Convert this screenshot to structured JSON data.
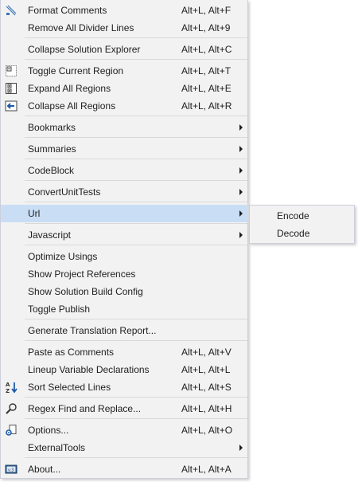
{
  "menu": {
    "format_comments": {
      "label": "Format Comments",
      "shortcut": "Alt+L, Alt+F",
      "icon": "comment-format-icon"
    },
    "remove_divider_lines": {
      "label": "Remove All Divider Lines",
      "shortcut": "Alt+L, Alt+9"
    },
    "collapse_solution_explorer": {
      "label": "Collapse Solution Explorer",
      "shortcut": "Alt+L, Alt+C"
    },
    "toggle_current_region": {
      "label": "Toggle Current Region",
      "shortcut": "Alt+L, Alt+T",
      "icon": "toggle-region-icon"
    },
    "expand_all_regions": {
      "label": "Expand All Regions",
      "shortcut": "Alt+L, Alt+E",
      "icon": "expand-regions-icon"
    },
    "collapse_all_regions": {
      "label": "Collapse All Regions",
      "shortcut": "Alt+L, Alt+R",
      "icon": "collapse-regions-icon"
    },
    "bookmarks": {
      "label": "Bookmarks"
    },
    "summaries": {
      "label": "Summaries"
    },
    "codeblock": {
      "label": "CodeBlock"
    },
    "convert_unit_tests": {
      "label": "ConvertUnitTests"
    },
    "url": {
      "label": "Url"
    },
    "javascript": {
      "label": "Javascript"
    },
    "optimize_usings": {
      "label": "Optimize Usings"
    },
    "show_project_references": {
      "label": "Show Project References"
    },
    "show_solution_build_config": {
      "label": "Show Solution Build Config"
    },
    "toggle_publish": {
      "label": "Toggle Publish"
    },
    "generate_translation_report": {
      "label": "Generate Translation Report..."
    },
    "paste_as_comments": {
      "label": "Paste as Comments",
      "shortcut": "Alt+L, Alt+V"
    },
    "lineup_variable_declarations": {
      "label": "Lineup Variable Declarations",
      "shortcut": "Alt+L, Alt+L"
    },
    "sort_selected_lines": {
      "label": "Sort Selected Lines",
      "shortcut": "Alt+L, Alt+S",
      "icon": "sort-az-icon"
    },
    "regex_find_replace": {
      "label": "Regex Find and Replace...",
      "shortcut": "Alt+L, Alt+H",
      "icon": "search-icon"
    },
    "options": {
      "label": "Options...",
      "shortcut": "Alt+L, Alt+O",
      "icon": "options-gear-icon"
    },
    "external_tools": {
      "label": "ExternalTools"
    },
    "about": {
      "label": "About...",
      "shortcut": "Alt+L, Alt+A",
      "icon": "about-icon"
    }
  },
  "submenu_url": {
    "encode": {
      "label": "Encode"
    },
    "decode": {
      "label": "Decode"
    }
  },
  "colors": {
    "menu_background": "#f2f2f2",
    "highlight": "#c9def5",
    "border": "#cccedb",
    "separator": "#d9d9d9",
    "icon_blue": "#1e5aa8"
  }
}
